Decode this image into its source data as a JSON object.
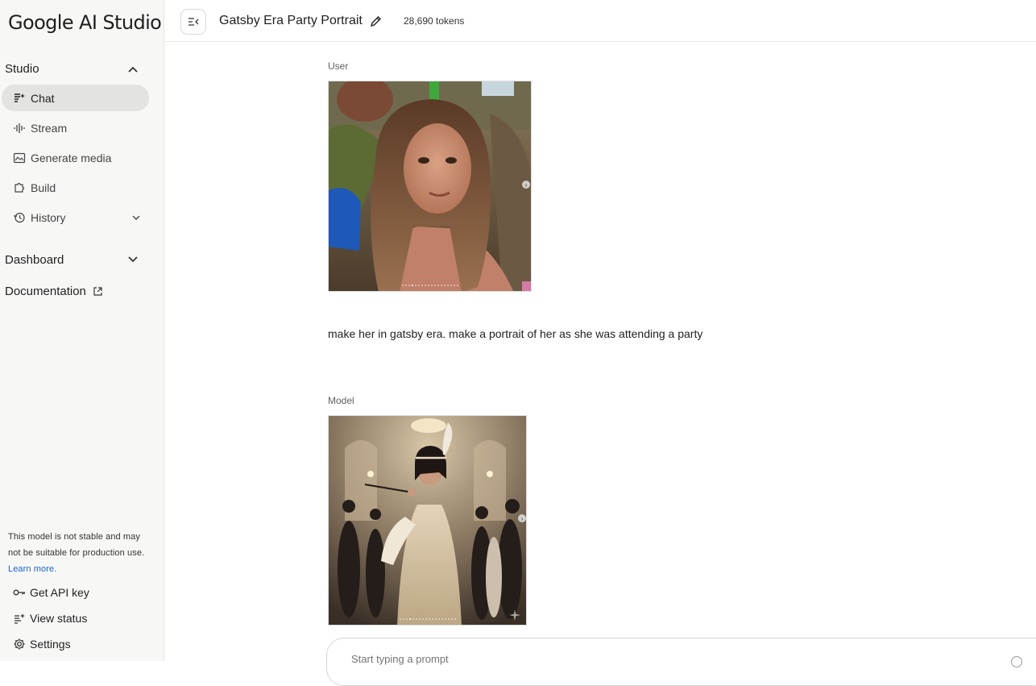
{
  "app": {
    "logo_text": "Google AI Studio"
  },
  "sidebar": {
    "studio_label": "Studio",
    "items": [
      {
        "label": "Chat",
        "icon": "chat-spark-icon",
        "active": true
      },
      {
        "label": "Stream",
        "icon": "stream-waveform-icon"
      },
      {
        "label": "Generate media",
        "icon": "image-icon"
      },
      {
        "label": "Build",
        "icon": "build-puzzle-icon"
      },
      {
        "label": "History",
        "icon": "history-icon"
      }
    ],
    "dashboard_label": "Dashboard",
    "documentation_label": "Documentation",
    "notice_text": "This model is not stable and may not be suitable for production use.",
    "notice_link": "Learn more.",
    "bottom_items": [
      {
        "label": "Get API key",
        "icon": "key-icon"
      },
      {
        "label": "View status",
        "icon": "status-icon"
      },
      {
        "label": "Settings",
        "icon": "gear-icon"
      }
    ]
  },
  "header": {
    "title": "Gatsby Era Party Portrait",
    "tokens": "28,690 tokens"
  },
  "chat": {
    "user_label": "User",
    "user_prompt": "make her in gatsby era. make a portrait of her as she was attending a party",
    "model_label": "Model"
  },
  "input": {
    "placeholder": "Start typing a prompt"
  }
}
